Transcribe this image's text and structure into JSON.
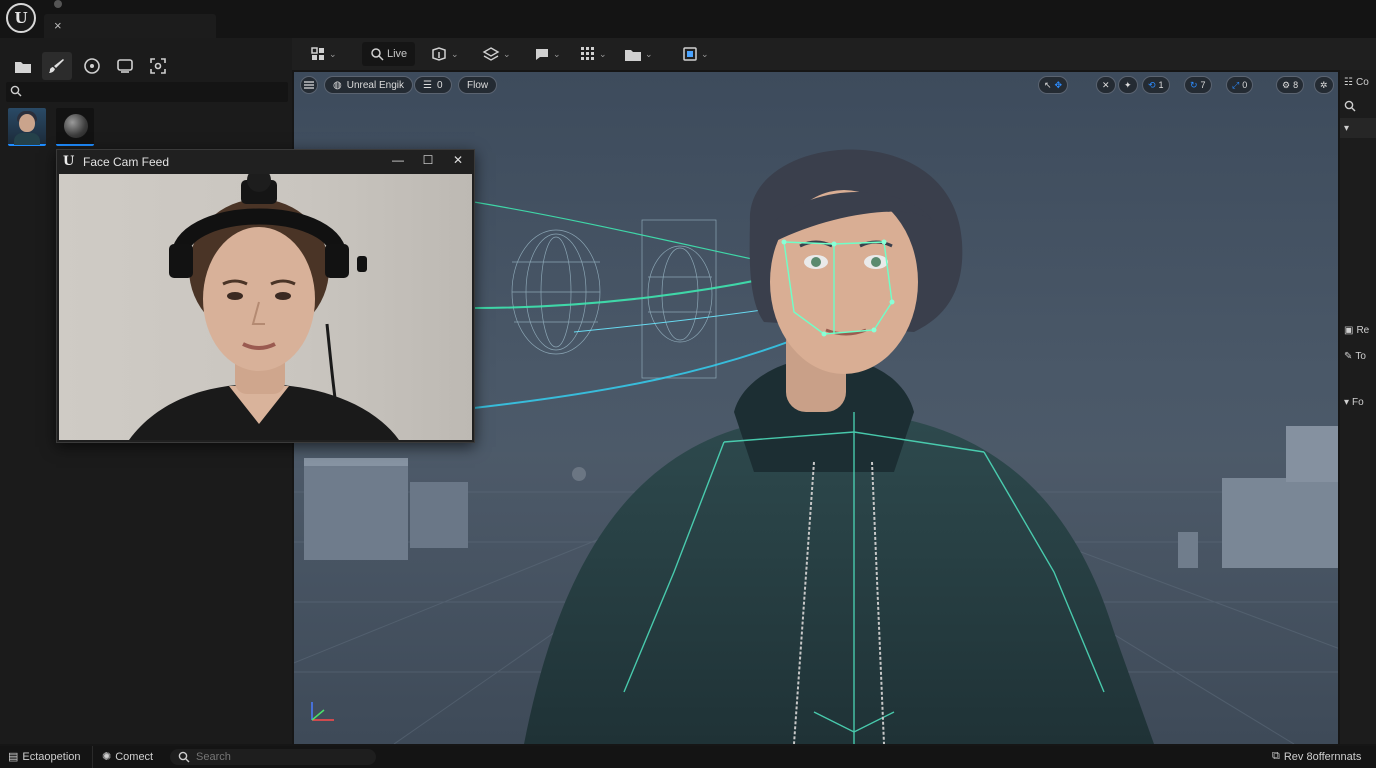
{
  "app": {
    "logo_text": "U",
    "tab_close": "×"
  },
  "facecam": {
    "logo": "U",
    "title": "Face Cam Feed",
    "minimize": "—",
    "maximize": "☐",
    "close": "✕"
  },
  "toolbar": {
    "live_label": "Live"
  },
  "viewport": {
    "pill_engine": "Unreal Engik",
    "pill_count": "0",
    "pill_flow": "Flow",
    "right_buttons": [
      {
        "icon": "transform-icon",
        "value": ""
      },
      {
        "icon": "snap-icon",
        "value": ""
      },
      {
        "icon": "bone-icon",
        "value": ""
      },
      {
        "icon": "rotate-snap-icon",
        "value": "1"
      },
      {
        "icon": "angle-icon",
        "value": "7"
      },
      {
        "icon": "scale-icon",
        "value": "0"
      },
      {
        "icon": "camera-speed-icon",
        "value": "8"
      },
      {
        "icon": "settings-icon",
        "value": ""
      }
    ],
    "accent_color": "#2c8cff",
    "tracking_color": "#3fe6b0"
  },
  "right_panel": {
    "row1": "Co",
    "row2": "Re",
    "row3": "To",
    "row4": "Fo"
  },
  "statusbar": {
    "item1": "Ectaopetion",
    "item2": "Comect",
    "search_placeholder": "Search",
    "item_right": "Rev 8offernnats"
  }
}
